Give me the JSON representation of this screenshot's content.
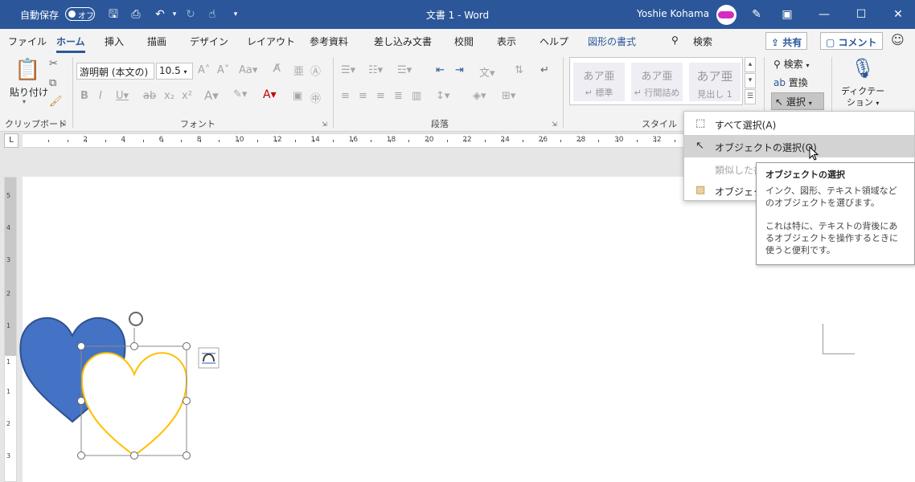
{
  "titlebar": {
    "autosave_label": "自動保存",
    "autosave_state": "オフ",
    "document_title": "文書 1  -  Word",
    "user_name": "Yoshie Kohama",
    "brand_color": "#2b579a"
  },
  "tabs": [
    {
      "label": "ファイル"
    },
    {
      "label": "ホーム"
    },
    {
      "label": "挿入"
    },
    {
      "label": "描画"
    },
    {
      "label": "デザイン"
    },
    {
      "label": "レイアウト"
    },
    {
      "label": "参考資料"
    },
    {
      "label": "差し込み文書"
    },
    {
      "label": "校閲"
    },
    {
      "label": "表示"
    },
    {
      "label": "ヘルプ"
    },
    {
      "label": "図形の書式"
    }
  ],
  "search_label": "検索",
  "share_label": "共有",
  "comment_label": "コメント",
  "ribbon": {
    "clipboard": {
      "group_label": "クリップボード",
      "paste_label": "貼り付け"
    },
    "font": {
      "group_label": "フォント",
      "font_name": "游明朝 (本文の)",
      "font_size": "10.5"
    },
    "paragraph": {
      "group_label": "段落"
    },
    "styles": {
      "group_label": "スタイル",
      "items": [
        {
          "sample": "あア亜",
          "name": "↵ 標準"
        },
        {
          "sample": "あア亜",
          "name": "↵ 行間詰め"
        },
        {
          "sample": "あア亜",
          "name": "見出し 1"
        }
      ]
    },
    "editing": {
      "search_label": "検索",
      "replace_label": "置換",
      "select_label": "選択"
    },
    "voice": {
      "dictate_line1": "ディクテー",
      "dictate_line2": "ション"
    }
  },
  "ruler": {
    "numbers": [
      "2",
      "4",
      "6",
      "8",
      "10",
      "12",
      "14",
      "16",
      "18",
      "20",
      "22",
      "24",
      "26",
      "28",
      "30",
      "32"
    ]
  },
  "vruler": {
    "numbers": [
      "5",
      "4",
      "3",
      "2",
      "1",
      "1",
      "1",
      "2",
      "3"
    ]
  },
  "select_menu": {
    "items": [
      {
        "label": "すべて選択(A)",
        "icon": "select-all-icon",
        "state": "normal"
      },
      {
        "label": "オブジェクトの選択(O)",
        "icon": "pointer-arrow-icon",
        "state": "hover"
      },
      {
        "label": "類似した書",
        "icon": "",
        "state": "disabled"
      },
      {
        "label": "オブジェクト",
        "icon": "selection-pane-icon",
        "state": "normal"
      }
    ]
  },
  "tooltip": {
    "title": "オブジェクトの選択",
    "line1": "インク、図形、テキスト領域などのオブジェクトを選びます。",
    "line2": "これは特に、テキストの背後にあるオブジェクトを操作するときに使うと便利です。"
  },
  "shapes": {
    "back_heart_fill": "#4472c4",
    "back_heart_stroke": "#2f528f",
    "front_heart_stroke": "#ffc000"
  }
}
